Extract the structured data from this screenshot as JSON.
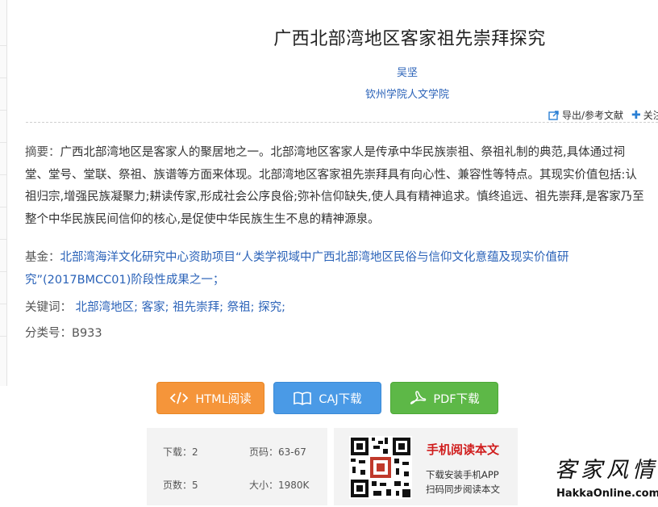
{
  "article": {
    "title": "广西北部湾地区客家祖先崇拜探究",
    "author": "吴坚",
    "institution": "钦州学院人文学院"
  },
  "toolbar": {
    "export_label": "导出/参考文献",
    "follow_label": "关注",
    "export_icon": "export-icon",
    "follow_icon": "plus-icon"
  },
  "abstract": {
    "label": "摘要：",
    "text": "广西北部湾地区是客家人的聚居地之一。北部湾地区客家人是传承中华民族崇祖、祭祖礼制的典范,具体通过祠堂、堂号、堂联、祭祖、族谱等方面来体现。北部湾地区客家祖先崇拜具有向心性、兼容性等特点。其现实价值包括:认祖归宗,增强民族凝聚力;耕读传家,形成社会公序良俗;弥补信仰缺失,使人具有精神追求。慎终追远、祖先崇拜,是客家乃至整个中华民族民间信仰的核心,是促使中华民族生生不息的精神源泉。"
  },
  "fund": {
    "label": "基金：",
    "text": "北部湾海洋文化研究中心资助项目“人类学视域中广西北部湾地区民俗与信仰文化意蕴及现实价值研究”(2017BMCC01)阶段性成果之一；"
  },
  "keywords": {
    "label": "关键词：",
    "items": [
      "北部湾地区;",
      "客家;",
      "祖先崇拜;",
      "祭祖;",
      "探究;"
    ]
  },
  "classification": {
    "label": "分类号：",
    "value": "B933"
  },
  "buttons": {
    "html": "HTML阅读",
    "caj": "CAJ下载",
    "pdf": "PDF下载"
  },
  "stats": {
    "downloads_label": "下载：",
    "downloads": "2",
    "pages_range_label": "页码：",
    "pages_range": "63-67",
    "page_count_label": "页数：",
    "page_count": "5",
    "size_label": "大小：",
    "size": "1980K"
  },
  "mobile": {
    "title": "手机阅读本文",
    "line1": "下载安装手机APP",
    "line2": "扫码同步阅读本文"
  },
  "watermark": {
    "logo_text": "客家风情",
    "url": "HakkaOnline.com"
  },
  "colors": {
    "link_blue": "#2a62b8",
    "html_button": "#f5953a",
    "caj_button": "#4a9ae6",
    "pdf_button": "#5db847",
    "mobile_title": "#d01d1d"
  }
}
